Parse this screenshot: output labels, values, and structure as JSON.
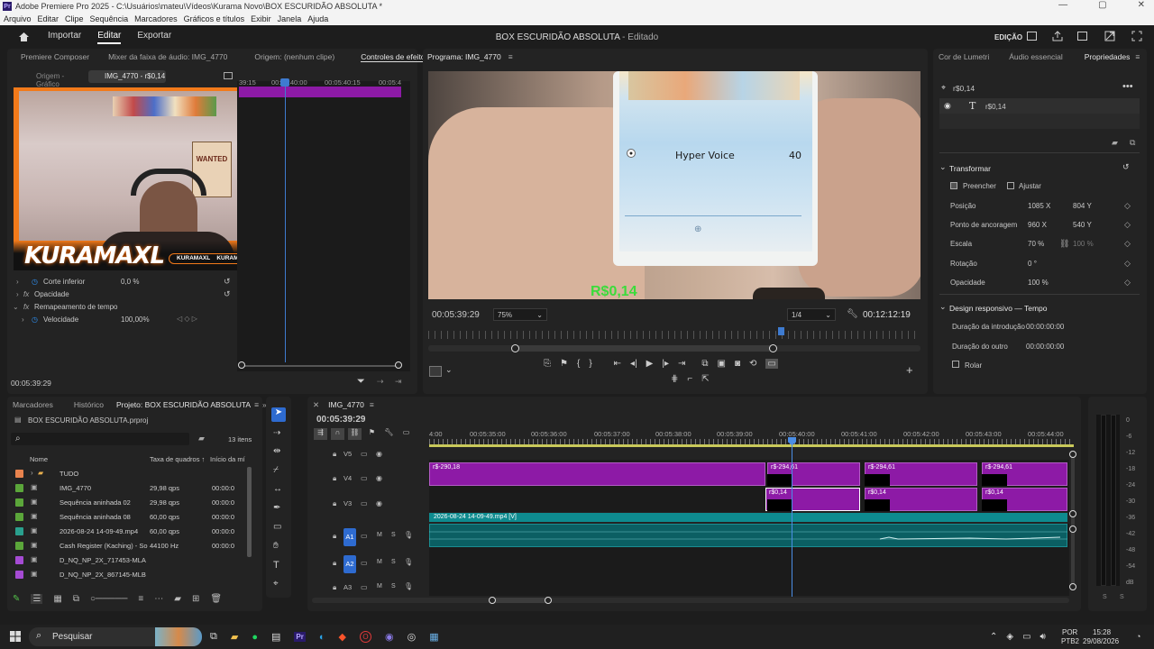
{
  "window": {
    "title": "Adobe Premiere Pro 2025 - C:\\Usuários\\mateu\\Vídeos\\Kurama Novo\\BOX ESCURIDÃO ABSOLUTA *",
    "min": "—",
    "max": "▢",
    "close": "✕"
  },
  "menu": [
    "Arquivo",
    "Editar",
    "Clipe",
    "Sequência",
    "Marcadores",
    "Gráficos e títulos",
    "Exibir",
    "Janela",
    "Ajuda"
  ],
  "appbar": {
    "import": "Importar",
    "edit": "Editar",
    "export": "Exportar",
    "doc_title": "BOX ESCURIDÃO ABSOLUTA",
    "doc_status": " - Editado",
    "workspace": "EDIÇÃO"
  },
  "source_panel": {
    "tabs": [
      "Premiere Composer",
      "Mixer da faixa de áudio: IMG_4770",
      "Origem: (nenhum clipe)",
      "Controles de efeitos"
    ],
    "subtabs": [
      "Origem - Gráfico",
      "IMG_4770 - r$0,14"
    ],
    "ruler": [
      "39:15",
      "00:05:40:00",
      "00:05:40:15",
      "00:05:4"
    ],
    "props": [
      {
        "label": "Corte inferior",
        "value": "0,0 %"
      },
      {
        "label": "Opacidade",
        "value": ""
      },
      {
        "label": "Remapeamento de tempo",
        "value": ""
      },
      {
        "label": "Velocidade",
        "value": "100,00%"
      }
    ],
    "timecode": "00:05:39:29",
    "overlay_brand": "KURAMAXL",
    "overlay_handles": [
      "KURAMAXL",
      "KURAMAXL"
    ],
    "overlay_wanted": "WANTED"
  },
  "program": {
    "title": "Programa: IMG_4770",
    "card_move": "Hyper Voice",
    "card_damage": "40",
    "price_overlay": "R$0,14",
    "timecode": "00:05:39:29",
    "zoom": "75%",
    "quality": "1/4",
    "duration": "00:12:12:19"
  },
  "properties": {
    "tabs": [
      "Cor de Lumetri",
      "Áudio essencial",
      "Propriedades"
    ],
    "object_name": "r$0,14",
    "layer_name": "r$0,14",
    "transform_header": "Transformar",
    "fill": "Preencher",
    "fit": "Ajustar",
    "rows": [
      {
        "label": "Posição",
        "v1": "1085",
        "u1": "X",
        "v2": "804",
        "u2": "Y"
      },
      {
        "label": "Ponto de ancoragem",
        "v1": "960",
        "u1": "X",
        "v2": "540",
        "u2": "Y"
      },
      {
        "label": "Escala",
        "v1": "70",
        "u1": "%",
        "v2": "100",
        "u2": "%"
      },
      {
        "label": "Rotação",
        "v1": "0",
        "u1": "°",
        "v2": "",
        "u2": ""
      },
      {
        "label": "Opacidade",
        "v1": "100",
        "u1": "%",
        "v2": "",
        "u2": ""
      }
    ],
    "responsive_header": "Design responsivo — Tempo",
    "intro_label": "Duração da introdução",
    "intro_value": "00:00:00:00",
    "outro_label": "Duração do outro",
    "outro_value": "00:00:00:00",
    "roll_label": "Rolar"
  },
  "project": {
    "tabs": [
      "Marcadores",
      "Histórico",
      "Projeto: BOX ESCURIDÃO ABSOLUTA"
    ],
    "file": "BOX ESCURIDÃO ABSOLUTA.prproj",
    "items_count": "13 itens",
    "col_name": "Nome",
    "col_fps": "Taxa de quadros",
    "col_start": "Início da mí",
    "items": [
      {
        "name": "TUDO",
        "fps": "",
        "start": "",
        "color": "#e8834e",
        "folder": true
      },
      {
        "name": "IMG_4770",
        "fps": "29,98 qps",
        "start": "00:00:0",
        "color": "#5ba63a",
        "folder": false
      },
      {
        "name": "Sequência aninhada 02",
        "fps": "29,98 qps",
        "start": "00:00:0",
        "color": "#5ba63a",
        "folder": false
      },
      {
        "name": "Sequência aninhada 08",
        "fps": "60,00 qps",
        "start": "00:00:0",
        "color": "#5ba63a",
        "folder": false
      },
      {
        "name": "2026-08-24 14-09-49.mp4",
        "fps": "60,00 qps",
        "start": "00:00:0",
        "color": "#2aa08e",
        "folder": false
      },
      {
        "name": "Cash Register (Kaching) - So",
        "fps": "44100 Hz",
        "start": "00:00:0",
        "color": "#5ba63a",
        "folder": false
      },
      {
        "name": "D_NQ_NP_2X_717453-MLA",
        "fps": "",
        "start": "",
        "color": "#a54bd3",
        "folder": false
      },
      {
        "name": "D_NQ_NP_2X_867145-MLB",
        "fps": "",
        "start": "",
        "color": "#a54bd3",
        "folder": false
      }
    ]
  },
  "timeline": {
    "title": "IMG_4770",
    "timecode": "00:05:39:29",
    "ruler": [
      "4:00",
      "00:05:35:00",
      "00:05:36:00",
      "00:05:37:00",
      "00:05:38:00",
      "00:05:39:00",
      "00:05:40:00",
      "00:05:41:00",
      "00:05:42:00",
      "00:05:43:00",
      "00:05:44:00"
    ],
    "tracks": [
      "V5",
      "V4",
      "V3",
      "A1",
      "A2",
      "A3"
    ],
    "clips_v4": [
      "r$-290,18",
      "r$-294,61",
      "r$-294,61",
      "r$-294,61"
    ],
    "clips_v3": [
      "r$0,14",
      "r$0,14",
      "r$0,14"
    ],
    "audio_clip": "2026-08-24 14-09-49.mp4 [V]"
  },
  "meter": {
    "labels": [
      "0",
      "-6",
      "-12",
      "-18",
      "-24",
      "-30",
      "-36",
      "-42",
      "-48",
      "-54",
      "dB"
    ],
    "solo": "S"
  },
  "taskbar": {
    "search": "Pesquisar",
    "lang1": "POR",
    "lang2": "PTB2",
    "time": "15:28",
    "date": "29/08/2026"
  }
}
